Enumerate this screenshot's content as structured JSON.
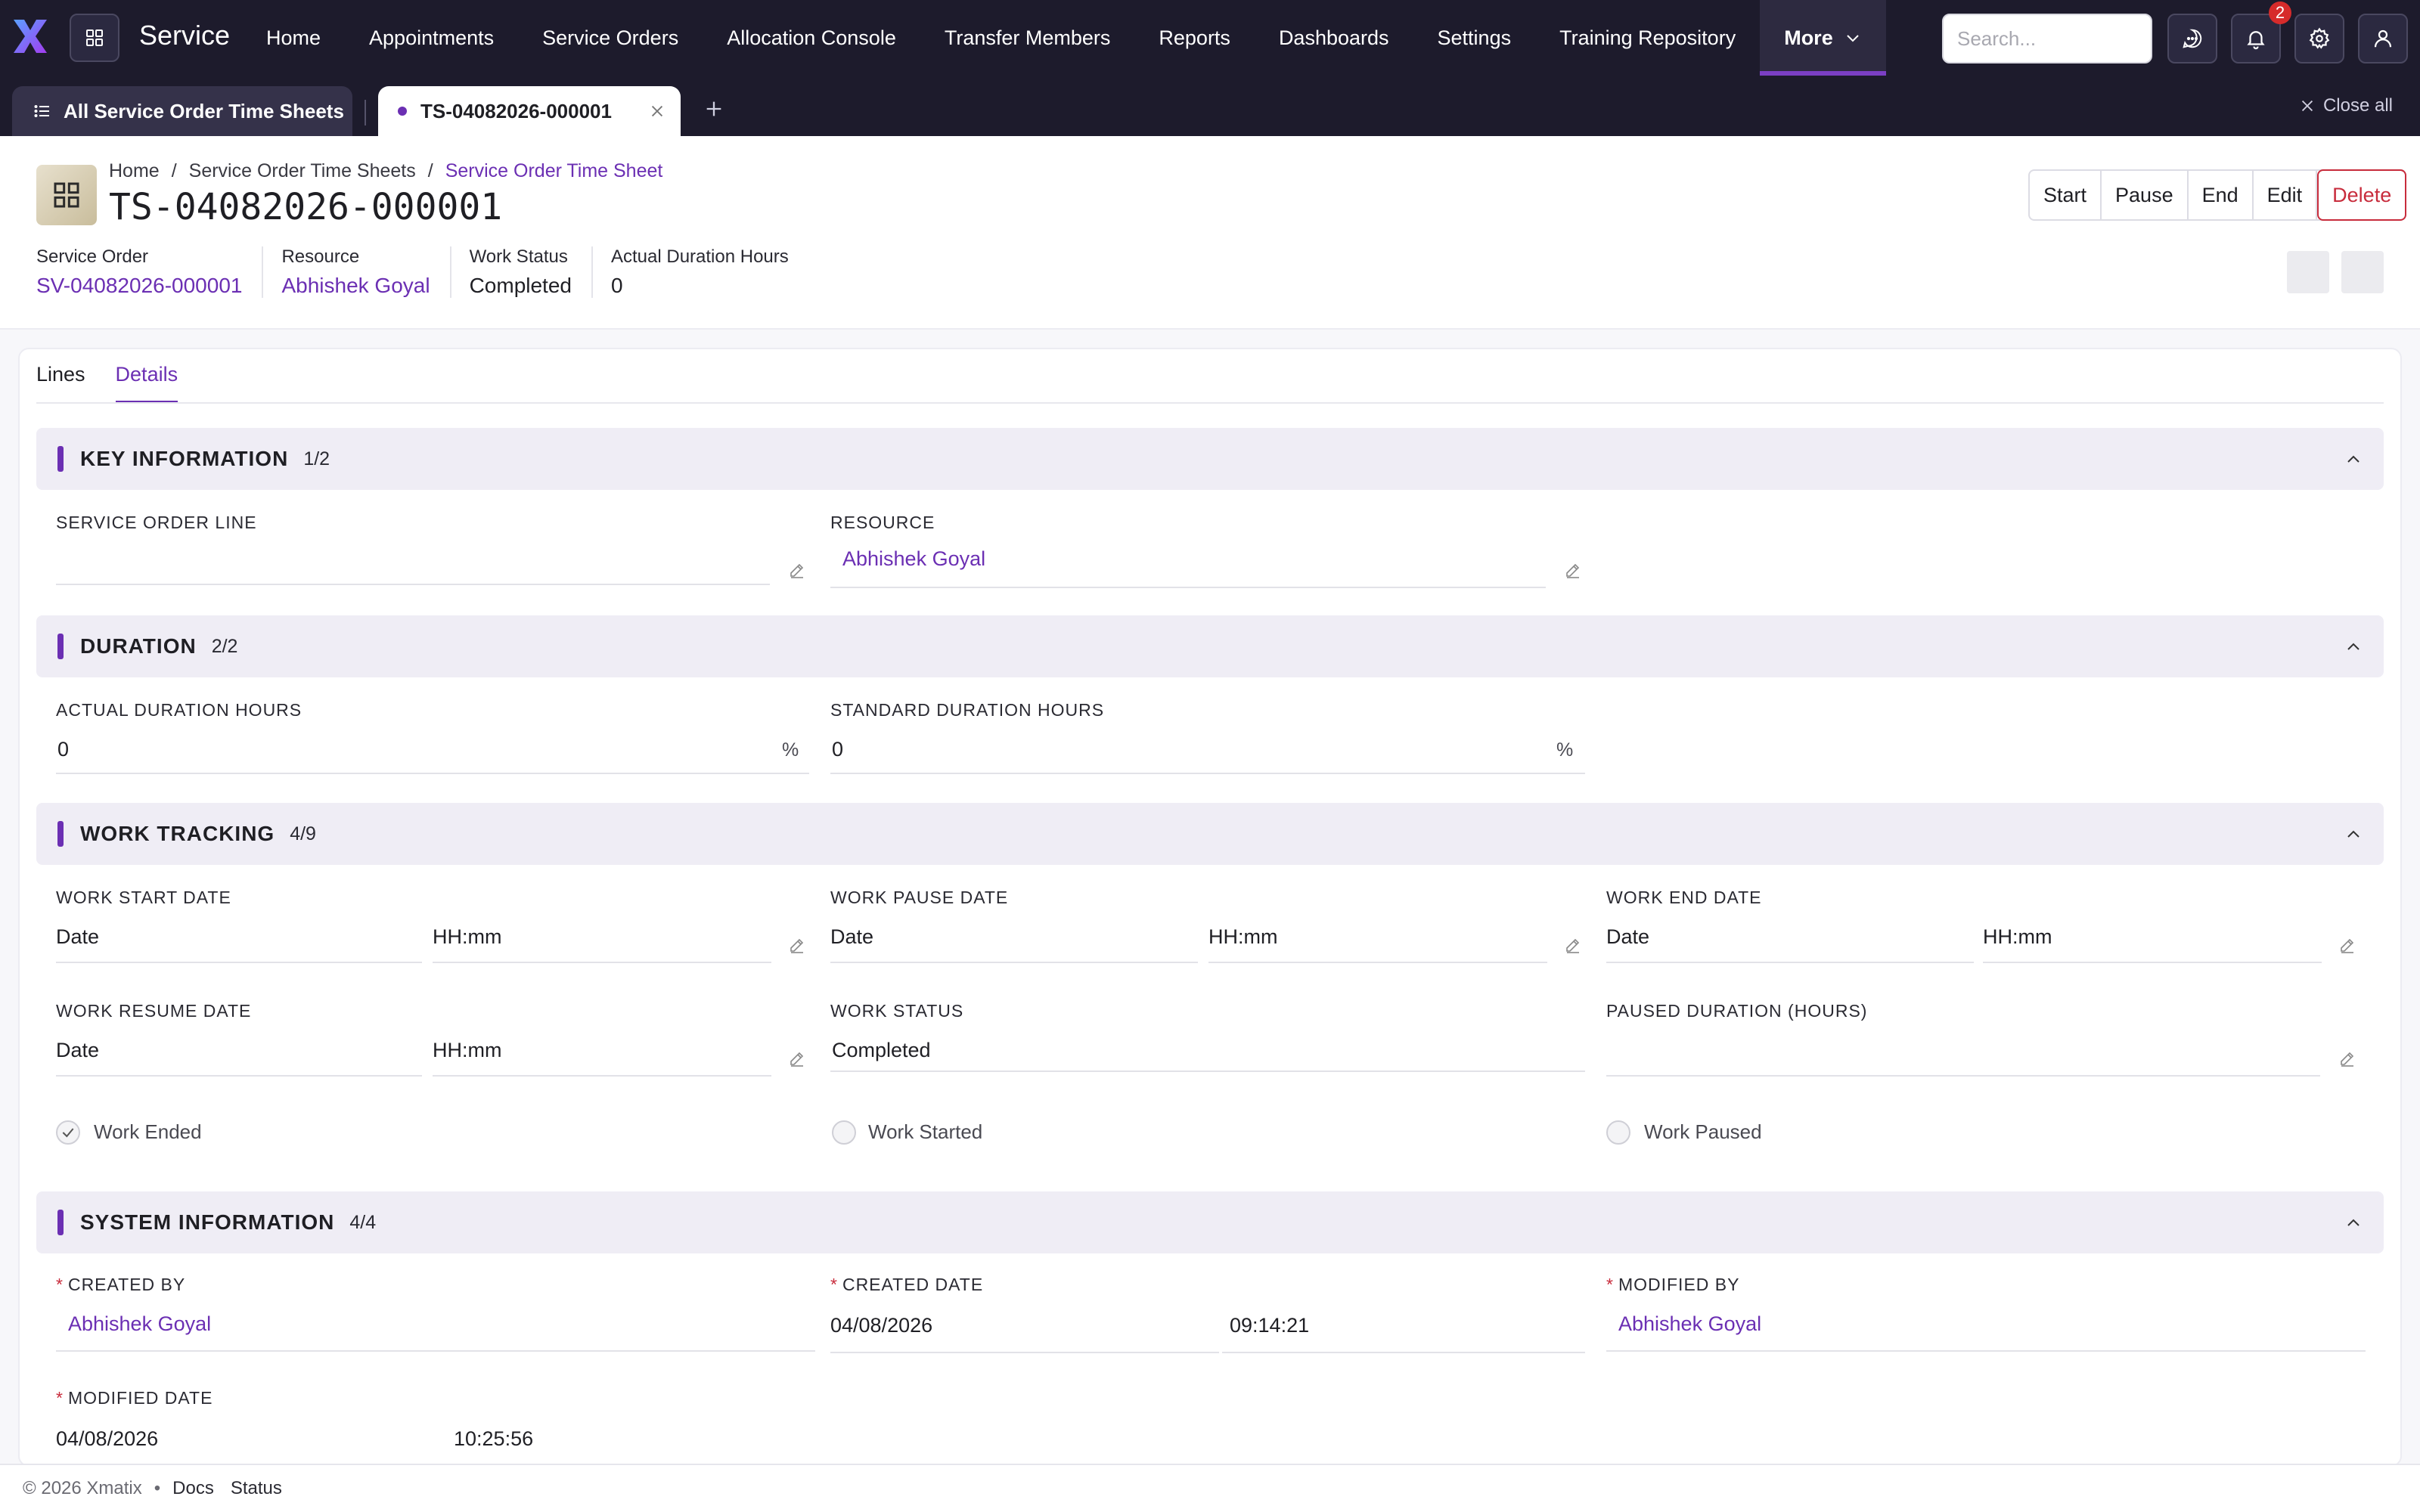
{
  "app": {
    "brand": "Service"
  },
  "nav": {
    "items": [
      "Home",
      "Appointments",
      "Service Orders",
      "Allocation Console",
      "Transfer Members",
      "Reports",
      "Dashboards",
      "Settings",
      "Training Repository"
    ],
    "more_label": "More"
  },
  "search": {
    "placeholder": "Search..."
  },
  "notifications": {
    "count": "2"
  },
  "tabs": {
    "list_tab": "All Service Order Time Sheets",
    "record_tab": "TS-04082026-000001",
    "close_all": "Close all"
  },
  "breadcrumb": {
    "home": "Home",
    "list": "Service Order Time Sheets",
    "current": "Service Order Time Sheet"
  },
  "record": {
    "title": "TS-04082026-000001"
  },
  "actions": {
    "start": "Start",
    "pause": "Pause",
    "end": "End",
    "edit": "Edit",
    "delete": "Delete"
  },
  "summary": [
    {
      "label": "Service Order",
      "value": "SV-04082026-000001"
    },
    {
      "label": "Resource",
      "value": "Abhishek Goyal"
    },
    {
      "label": "Work Status",
      "value": "Completed"
    },
    {
      "label": "Actual Duration Hours",
      "value": "0"
    }
  ],
  "subtabs": {
    "lines": "Lines",
    "details": "Details"
  },
  "sections": {
    "key": {
      "title": "KEY INFORMATION",
      "count": "1/2"
    },
    "duration": {
      "title": "DURATION",
      "count": "2/2"
    },
    "tracking": {
      "title": "WORK TRACKING",
      "count": "4/9"
    },
    "system": {
      "title": "SYSTEM INFORMATION",
      "count": "4/4"
    }
  },
  "fields": {
    "service_order_line": {
      "label": "SERVICE ORDER LINE",
      "value": ""
    },
    "resource": {
      "label": "RESOURCE",
      "value": "Abhishek Goyal"
    },
    "actual_duration": {
      "label": "ACTUAL DURATION HOURS",
      "value": "0",
      "unit": "%"
    },
    "standard_duration": {
      "label": "STANDARD DURATION HOURS",
      "value": "0",
      "unit": "%"
    },
    "work_start": {
      "label": "WORK START DATE",
      "date_placeholder": "Date",
      "time_placeholder": "HH:mm"
    },
    "work_pause": {
      "label": "WORK PAUSE DATE",
      "date_placeholder": "Date",
      "time_placeholder": "HH:mm"
    },
    "work_end": {
      "label": "WORK END DATE",
      "date_placeholder": "Date",
      "time_placeholder": "HH:mm"
    },
    "work_resume": {
      "label": "WORK RESUME DATE",
      "date_placeholder": "Date",
      "time_placeholder": "HH:mm"
    },
    "work_status": {
      "label": "WORK STATUS",
      "value": "Completed"
    },
    "paused_duration": {
      "label": "PAUSED DURATION (HOURS)",
      "value": ""
    },
    "created_by": {
      "label": "CREATED BY",
      "value": "Abhishek Goyal"
    },
    "created_date": {
      "label": "CREATED DATE",
      "date": "04/08/2026",
      "time": "09:14:21"
    },
    "modified_by": {
      "label": "MODIFIED BY",
      "value": "Abhishek Goyal"
    },
    "modified_date": {
      "label": "MODIFIED DATE",
      "date": "04/08/2026",
      "time": "10:25:56"
    }
  },
  "checkboxes": {
    "work_ended": {
      "label": "Work Ended",
      "checked": true
    },
    "work_started": {
      "label": "Work Started",
      "checked": false
    },
    "work_paused": {
      "label": "Work Paused",
      "checked": false
    }
  },
  "footer": {
    "copyright": "© 2026 Xmatix",
    "docs": "Docs",
    "status": "Status"
  },
  "colors": {
    "accent": "#6b2fb3",
    "nav_bg": "#1d1b2c",
    "danger": "#c82c3c"
  }
}
